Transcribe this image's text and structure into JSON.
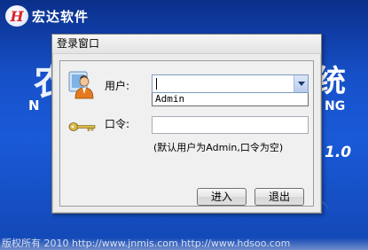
{
  "background": {
    "logo_mark": "H",
    "company_name": "宏达软件",
    "title_partial": "农",
    "title_partial_right": "统",
    "subtitle_left": "N",
    "subtitle_right": "NG",
    "version": "1.0",
    "footer_text": "版权所有 2010 http://www.jnmis.com   http://www.hdsoo.com"
  },
  "dialog": {
    "title": "登录窗口",
    "user_label": "用户:",
    "user_value": "",
    "dropdown_options": [
      "Admin"
    ],
    "password_label": "口令:",
    "password_value": "",
    "hint": "(默认用户为Admin,口令为空)",
    "login_button": "进入",
    "exit_button": "退出"
  }
}
